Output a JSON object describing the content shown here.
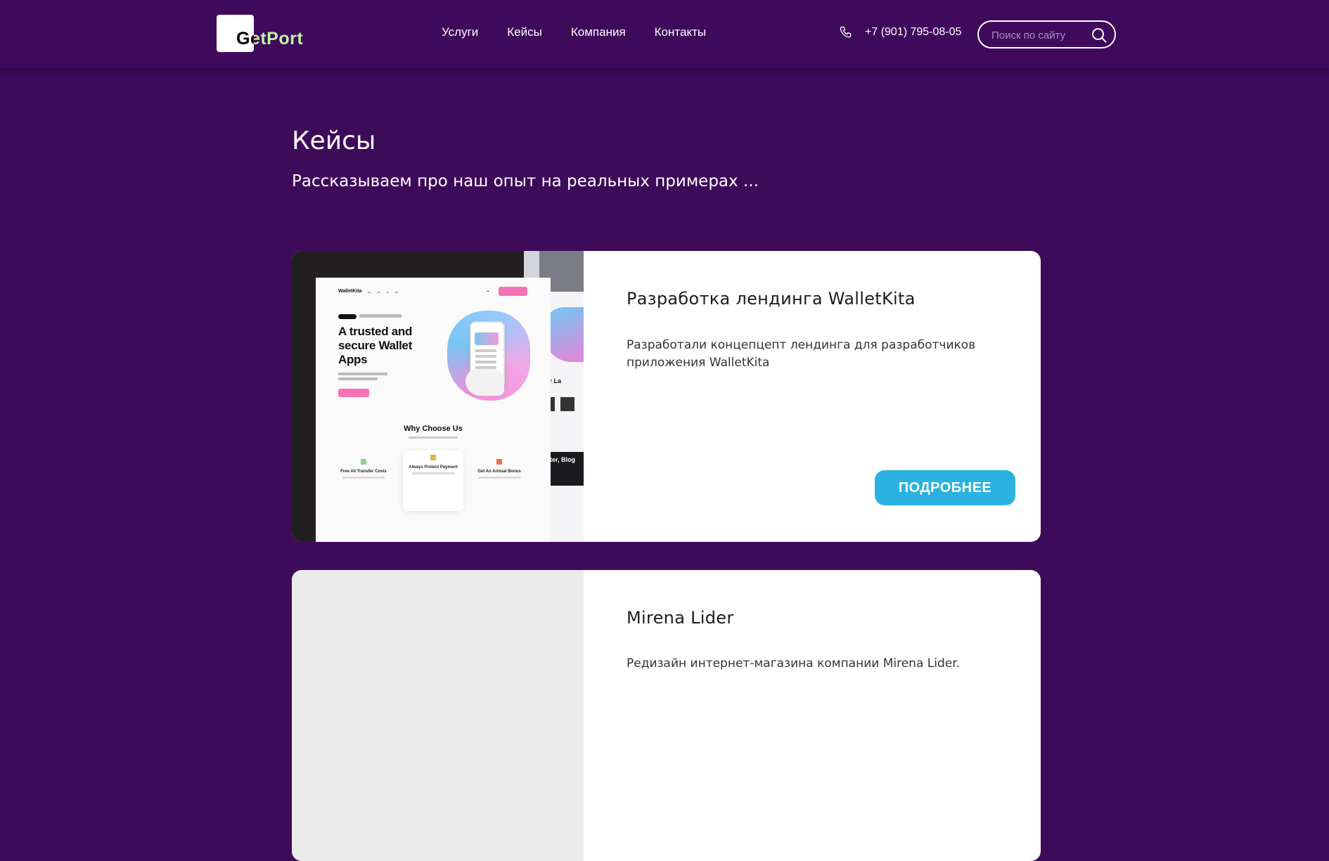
{
  "header": {
    "logo_text": "GetPort",
    "nav": [
      "Услуги",
      "Кейсы",
      "Компания",
      "Контакты"
    ],
    "phone": "+7 (901) 795-08-05",
    "search_placeholder": "Поиск по сайту"
  },
  "page": {
    "title": "Кейсы",
    "subtitle": "Рассказываем про наш опыт на реальных примерах ..."
  },
  "cases": [
    {
      "title": "Разработка лендинга WalletKita",
      "description": "Разработали концепцепт лендинга для разработчиков приложения WalletKita",
      "button": "ПОДРОБНЕЕ",
      "preview": {
        "logo": "WalletKita",
        "headline": "A trusted and secure Wallet Apps",
        "section": "Why Choose Us",
        "features": [
          "Free All Transfer Costs",
          "Always Protect Payment",
          "Get An Annual Bonus"
        ],
        "side_heading": "Our La",
        "side_banner": "ibe Our tter, Blog"
      }
    },
    {
      "title": "Mirena Lider",
      "description": "Редизайн интернет-магазина компании Mirena Lider."
    }
  ],
  "colors": {
    "background": "#3e0a5a",
    "card": "#ffffff",
    "button": "#29b2e0"
  }
}
